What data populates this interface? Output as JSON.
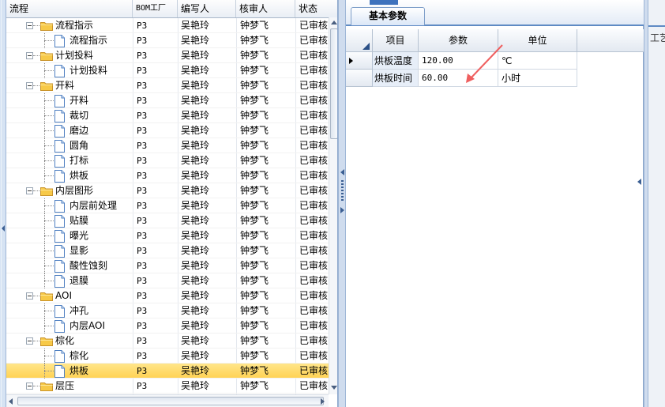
{
  "tree": {
    "columns": [
      "流程",
      "BOM工厂",
      "编写人",
      "核审人",
      "状态"
    ],
    "rows": [
      {
        "name": "流程指示",
        "level": 1,
        "type": "folder",
        "bom": "P3",
        "writer": "吴艳玲",
        "reviewer": "钟梦飞",
        "status": "已审核"
      },
      {
        "name": "流程指示",
        "level": 2,
        "type": "doc",
        "bom": "P3",
        "writer": "吴艳玲",
        "reviewer": "钟梦飞",
        "status": "已审核"
      },
      {
        "name": "计划投料",
        "level": 1,
        "type": "folder",
        "bom": "P3",
        "writer": "吴艳玲",
        "reviewer": "钟梦飞",
        "status": "已审核"
      },
      {
        "name": "计划投料",
        "level": 2,
        "type": "doc",
        "bom": "P3",
        "writer": "吴艳玲",
        "reviewer": "钟梦飞",
        "status": "已审核"
      },
      {
        "name": "开料",
        "level": 1,
        "type": "folder",
        "bom": "P3",
        "writer": "吴艳玲",
        "reviewer": "钟梦飞",
        "status": "已审核"
      },
      {
        "name": "开料",
        "level": 2,
        "type": "doc",
        "bom": "P3",
        "writer": "吴艳玲",
        "reviewer": "钟梦飞",
        "status": "已审核"
      },
      {
        "name": "裁切",
        "level": 2,
        "type": "doc",
        "bom": "P3",
        "writer": "吴艳玲",
        "reviewer": "钟梦飞",
        "status": "已审核"
      },
      {
        "name": "磨边",
        "level": 2,
        "type": "doc",
        "bom": "P3",
        "writer": "吴艳玲",
        "reviewer": "钟梦飞",
        "status": "已审核"
      },
      {
        "name": "圆角",
        "level": 2,
        "type": "doc",
        "bom": "P3",
        "writer": "吴艳玲",
        "reviewer": "钟梦飞",
        "status": "已审核"
      },
      {
        "name": "打标",
        "level": 2,
        "type": "doc",
        "bom": "P3",
        "writer": "吴艳玲",
        "reviewer": "钟梦飞",
        "status": "已审核"
      },
      {
        "name": "烘板",
        "level": 2,
        "type": "doc",
        "bom": "P3",
        "writer": "吴艳玲",
        "reviewer": "钟梦飞",
        "status": "已审核"
      },
      {
        "name": "内层图形",
        "level": 1,
        "type": "folder",
        "bom": "P3",
        "writer": "吴艳玲",
        "reviewer": "钟梦飞",
        "status": "已审核"
      },
      {
        "name": "内层前处理",
        "level": 2,
        "type": "doc",
        "bom": "P3",
        "writer": "吴艳玲",
        "reviewer": "钟梦飞",
        "status": "已审核"
      },
      {
        "name": "贴膜",
        "level": 2,
        "type": "doc",
        "bom": "P3",
        "writer": "吴艳玲",
        "reviewer": "钟梦飞",
        "status": "已审核"
      },
      {
        "name": "曝光",
        "level": 2,
        "type": "doc",
        "bom": "P3",
        "writer": "吴艳玲",
        "reviewer": "钟梦飞",
        "status": "已审核"
      },
      {
        "name": "显影",
        "level": 2,
        "type": "doc",
        "bom": "P3",
        "writer": "吴艳玲",
        "reviewer": "钟梦飞",
        "status": "已审核"
      },
      {
        "name": "酸性蚀刻",
        "level": 2,
        "type": "doc",
        "bom": "P3",
        "writer": "吴艳玲",
        "reviewer": "钟梦飞",
        "status": "已审核"
      },
      {
        "name": "退膜",
        "level": 2,
        "type": "doc",
        "bom": "P3",
        "writer": "吴艳玲",
        "reviewer": "钟梦飞",
        "status": "已审核"
      },
      {
        "name": "AOI",
        "level": 1,
        "type": "folder",
        "bom": "P3",
        "writer": "吴艳玲",
        "reviewer": "钟梦飞",
        "status": "已审核"
      },
      {
        "name": "冲孔",
        "level": 2,
        "type": "doc",
        "bom": "P3",
        "writer": "吴艳玲",
        "reviewer": "钟梦飞",
        "status": "已审核"
      },
      {
        "name": "内层AOI",
        "level": 2,
        "type": "doc",
        "bom": "P3",
        "writer": "吴艳玲",
        "reviewer": "钟梦飞",
        "status": "已审核"
      },
      {
        "name": "棕化",
        "level": 1,
        "type": "folder",
        "bom": "P3",
        "writer": "吴艳玲",
        "reviewer": "钟梦飞",
        "status": "已审核"
      },
      {
        "name": "棕化",
        "level": 2,
        "type": "doc",
        "bom": "P3",
        "writer": "吴艳玲",
        "reviewer": "钟梦飞",
        "status": "已审核"
      },
      {
        "name": "烘板",
        "level": 2,
        "type": "doc",
        "bom": "P3",
        "writer": "吴艳玲",
        "reviewer": "钟梦飞",
        "status": "已审核",
        "selected": true
      },
      {
        "name": "层压",
        "level": 1,
        "type": "folder",
        "bom": "P3",
        "writer": "吴艳玲",
        "reviewer": "钟梦飞",
        "status": "已审核"
      }
    ]
  },
  "right": {
    "tab_label": "基本参数",
    "grid": {
      "columns": [
        "项目",
        "参数",
        "单位"
      ],
      "rows": [
        {
          "item": "烘板温度",
          "value": "120.00",
          "unit": "℃",
          "current": true
        },
        {
          "item": "烘板时间",
          "value": "60.00",
          "unit": "小时"
        }
      ]
    }
  },
  "far_right": {
    "tab_label": "工艺"
  },
  "colors": {
    "selected_row": "#ffd96b",
    "accent": "#5f8bc4",
    "annotation_arrow": "#ef5f5f"
  }
}
